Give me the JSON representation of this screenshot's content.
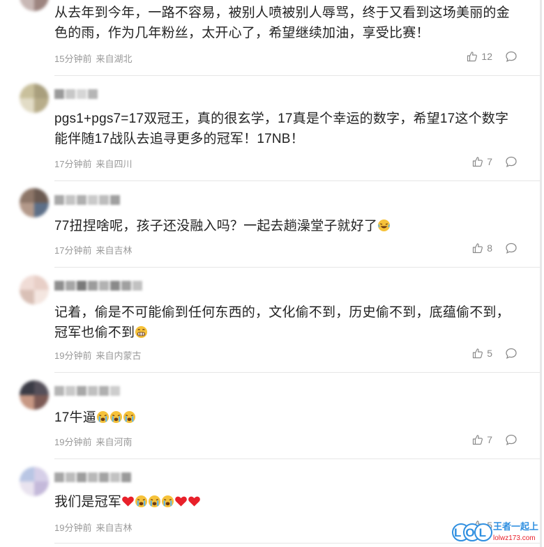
{
  "comments": [
    {
      "text": "从去年到今年，一路不容易，被别人喷被别人辱骂，终于又看到这场美丽的金色的雨，作为几年粉丝，太开心了，希望继续加油，享受比赛！",
      "time": "15分钟前",
      "location": "来自湖北",
      "likes": "12"
    },
    {
      "text": "pgs1+pgs7=17双冠王，真的很玄学，17真是个幸运的数字，希望17这个数字能伴随17战队去追寻更多的冠军！17NB！",
      "time": "17分钟前",
      "location": "来自四川",
      "likes": "7"
    },
    {
      "text": "77扭捏啥呢，孩子还没融入吗？一起去趟澡堂子就好了",
      "time": "17分钟前",
      "location": "来自吉林",
      "likes": "8"
    },
    {
      "text": "记着，偷是不可能偷到任何东西的，文化偷不到，历史偷不到，底蕴偷不到，冠军也偷不到",
      "time": "19分钟前",
      "location": "来自内蒙古",
      "likes": "5"
    },
    {
      "text": "17牛逼",
      "time": "19分钟前",
      "location": "来自河南",
      "likes": "7"
    },
    {
      "text": "我们是冠军",
      "time": "19分钟前",
      "location": "来自吉林",
      "likes": "5"
    }
  ],
  "watermark": {
    "brand": "LOL",
    "slogan": "王者一起上",
    "url": "lolwz173.com"
  },
  "colors": {
    "text": "#222222",
    "meta": "#999999",
    "divider": "#e6e6e6",
    "heart": "#e8202a",
    "emoji": "#f6c23a",
    "watermark_blue": "#2f8fe0"
  }
}
